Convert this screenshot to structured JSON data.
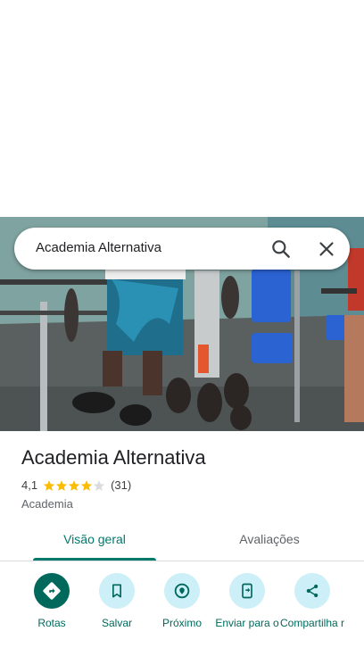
{
  "search": {
    "query": "Academia Alternativa"
  },
  "place": {
    "title": "Academia Alternativa",
    "rating": "4,1",
    "stars": 4.1,
    "review_count": "(31)",
    "category": "Academia"
  },
  "tabs": [
    {
      "label": "Visão geral",
      "active": true
    },
    {
      "label": "Avaliações",
      "active": false
    }
  ],
  "actions": [
    {
      "label": "Rotas",
      "icon": "directions-icon"
    },
    {
      "label": "Salvar",
      "icon": "bookmark-icon"
    },
    {
      "label": "Próximo",
      "icon": "nearby-icon"
    },
    {
      "label": "Enviar para o",
      "icon": "send-to-phone-icon"
    },
    {
      "label": "Compartilha r",
      "icon": "share-icon"
    }
  ],
  "colors": {
    "accent": "#00796b",
    "action_bg": "#cdeff7",
    "star": "#fbbc04"
  }
}
